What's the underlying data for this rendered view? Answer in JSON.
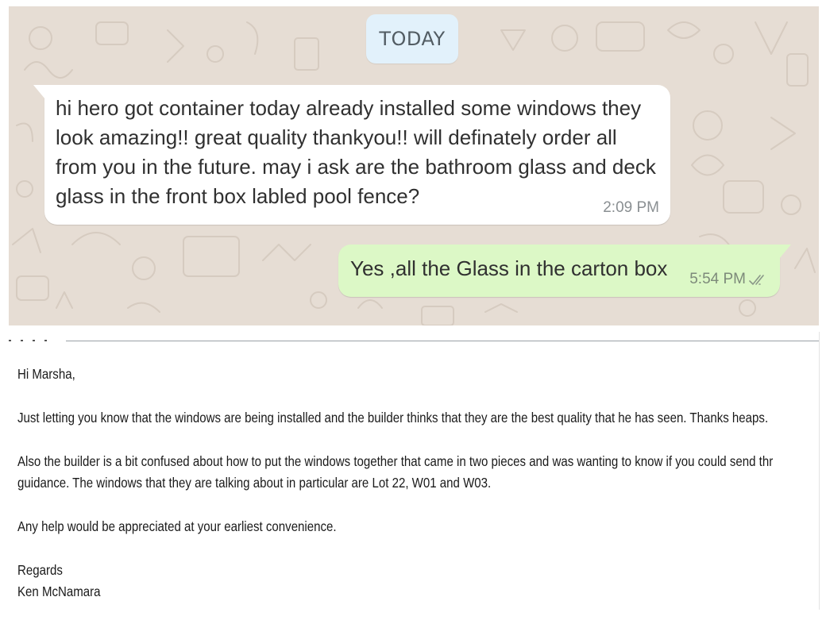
{
  "chat": {
    "date_chip": "TODAY",
    "incoming": {
      "text": "hi hero got container today already installed some windows they\nlook amazing!! great quality thankyou!! will definately order all\nfrom you in the future. may i ask are the bathroom glass and deck\nglass in the front box labled pool fence?",
      "time": "2:09 PM"
    },
    "outgoing": {
      "text": "Yes ,all the Glass in the carton box",
      "time": "5:54 PM",
      "status_icon": "double-check-icon"
    },
    "colors": {
      "wallpaper": "#e6ddd4",
      "incoming_bubble": "#ffffff",
      "outgoing_bubble": "#dcf8c6",
      "date_chip": "#e2f1fb"
    }
  },
  "email": {
    "greeting": "Hi Marsha,",
    "paragraph_1": "Just letting you know that the windows are being installed and the builder thinks that they are the best quality that he has seen.  Thanks heaps.",
    "paragraph_2_line_1": "Also the builder is a bit confused about how to put the windows together that came in two pieces and was wanting to know if you could send thr",
    "paragraph_2_line_2": "guidance.  The windows that they are talking about in particular are Lot 22, W01 and W03.",
    "paragraph_3": "Any help would be appreciated at your earliest convenience.",
    "closing": "Regards",
    "signature_name": "Ken McNamara"
  }
}
